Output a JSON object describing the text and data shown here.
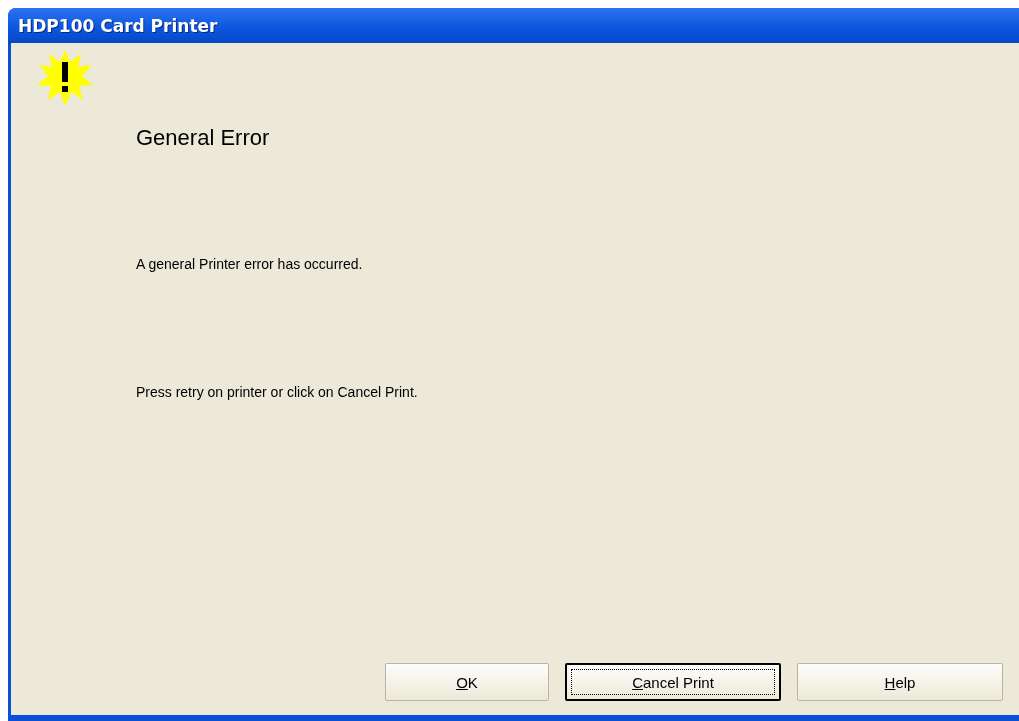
{
  "window": {
    "title": "HDP100 Card Printer"
  },
  "heading": "General Error",
  "messages": [
    "A general Printer error has occurred.",
    "Press retry on printer or click on Cancel Print."
  ],
  "buttons": [
    {
      "label": "OK",
      "focused": false
    },
    {
      "label": "Cancel Print",
      "focused": true
    },
    {
      "label": "Help",
      "focused": false
    }
  ]
}
